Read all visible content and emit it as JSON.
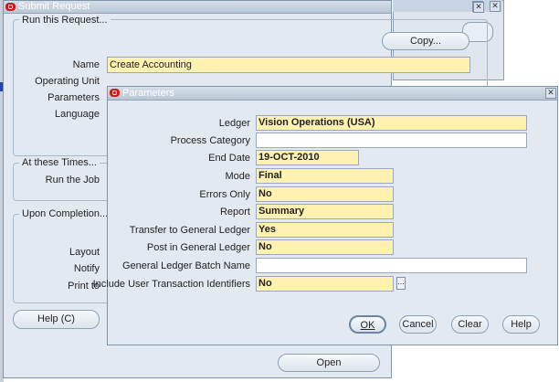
{
  "submit_request": {
    "title": "Submit Request",
    "run_group_label": "Run this Request...",
    "copy_button": "Copy...",
    "name_label": "Name",
    "name_value": "Create Accounting",
    "operating_unit_label": "Operating Unit",
    "parameters_label": "Parameters",
    "language_label": "Language",
    "times_group_label": "At these Times...",
    "run_job_label": "Run the Job",
    "completion_group_label": "Upon Completion...",
    "layout_label": "Layout",
    "notify_label": "Notify",
    "print_to_label": "Print to",
    "help_button": "Help (C)",
    "open_button": "Open"
  },
  "parameters": {
    "title": "Parameters",
    "fields": [
      {
        "label": "Ledger",
        "value": "Vision Operations (USA)",
        "style": "yellow"
      },
      {
        "label": "Process Category",
        "value": "",
        "style": "white"
      },
      {
        "label": "End Date",
        "value": "19-OCT-2010",
        "style": "yellow"
      },
      {
        "label": "Mode",
        "value": "Final",
        "style": "yellow"
      },
      {
        "label": "Errors Only",
        "value": "No",
        "style": "yellow"
      },
      {
        "label": "Report",
        "value": "Summary",
        "style": "yellow"
      },
      {
        "label": "Transfer to General Ledger",
        "value": "Yes",
        "style": "yellow"
      },
      {
        "label": "Post in General Ledger",
        "value": "No",
        "style": "yellow"
      },
      {
        "label": "General Ledger Batch Name",
        "value": "",
        "style": "white"
      },
      {
        "label": "Include User Transaction Identifiers",
        "value": "No",
        "style": "yellow"
      }
    ],
    "lov_button": "...",
    "buttons": {
      "ok": "OK",
      "cancel": "Cancel",
      "clear": "Clear",
      "help": "Help"
    }
  },
  "colors": {
    "window_bg": "#e3e9f0",
    "required_field": "#fff2b0",
    "title_text": "#ffffff",
    "oracle_red": "#cc1a1a"
  }
}
